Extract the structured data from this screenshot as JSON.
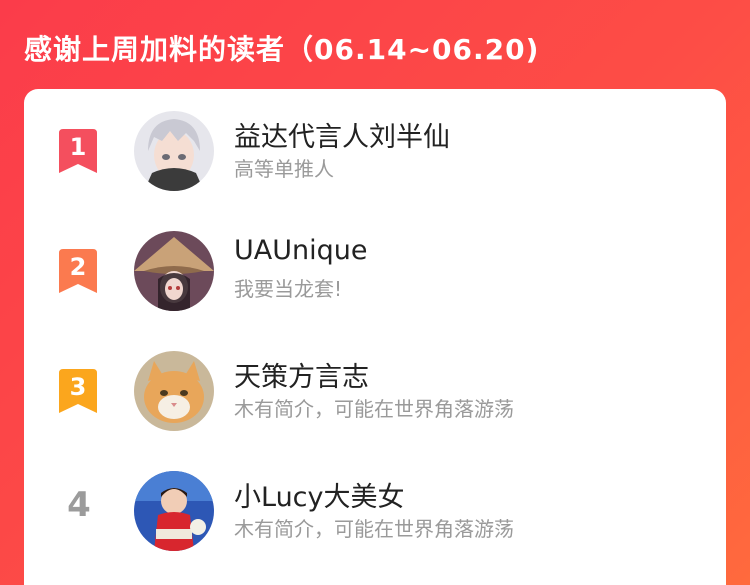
{
  "header": {
    "title": "感谢上周加料的读者（06.14~06.20)"
  },
  "readers": [
    {
      "rank": "1",
      "name": "益达代言人刘半仙",
      "bio": "高等单推人",
      "badge_color": "#f44f5e",
      "avatar_icon": "anime-silver-hair-avatar"
    },
    {
      "rank": "2",
      "name": "UAUnique",
      "bio": "我要当龙套!",
      "badge_color": "#fb7a4f",
      "avatar_icon": "anime-straw-hat-avatar"
    },
    {
      "rank": "3",
      "name": "天策方言志",
      "bio": "木有简介，可能在世界角落游荡",
      "badge_color": "#fba61d",
      "avatar_icon": "orange-cat-avatar"
    },
    {
      "rank": "4",
      "name": "小Lucy大美女",
      "bio": "木有简介，可能在世界角落游荡",
      "badge_color": "#9b9b9b",
      "avatar_icon": "child-photo-avatar"
    }
  ]
}
